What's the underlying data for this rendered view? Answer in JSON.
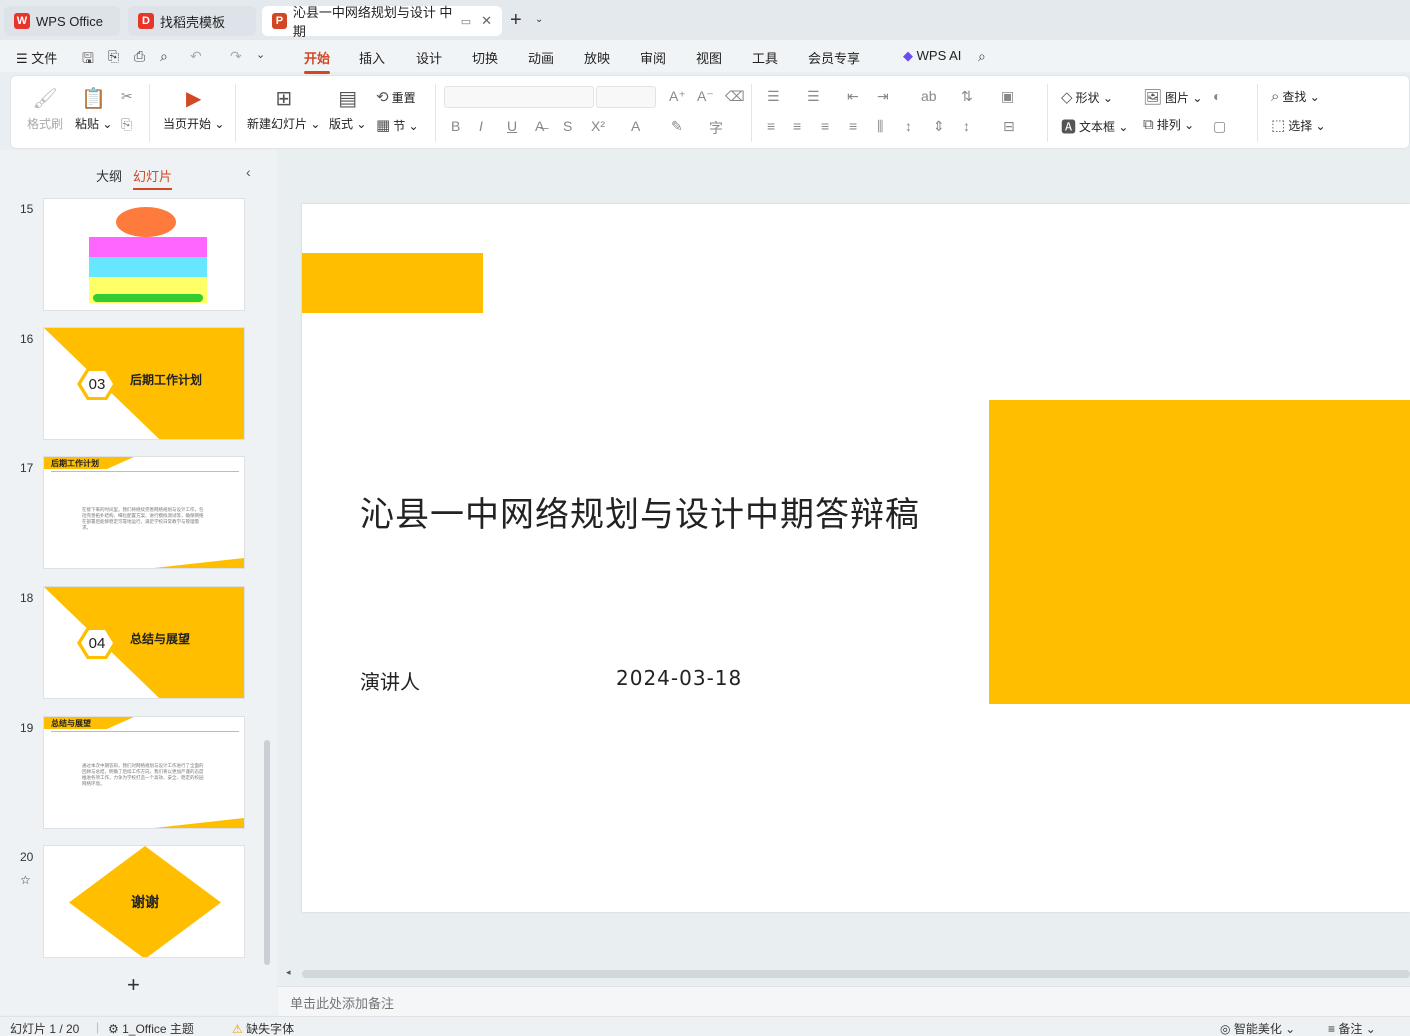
{
  "tabs": [
    {
      "label": "WPS Office",
      "logo": "W"
    },
    {
      "label": "找稻壳模板",
      "logo": "D"
    },
    {
      "label": "沁县一中网络规划与设计 中期",
      "logo": "P"
    }
  ],
  "menu": {
    "file": "文件",
    "items": [
      "开始",
      "插入",
      "设计",
      "切换",
      "动画",
      "放映",
      "审阅",
      "视图",
      "工具",
      "会员专享"
    ],
    "active": "开始",
    "ai": "WPS AI"
  },
  "ribbon": {
    "format_painter": "格式刷",
    "paste": "粘贴",
    "play_from_current": "当页开始",
    "new_slide": "新建幻灯片",
    "layout": "版式",
    "reset": "重置",
    "section": "节",
    "shape": "形状",
    "picture": "图片",
    "textbox": "文本框",
    "arrange": "排列",
    "find": "查找",
    "select": "选择"
  },
  "left_panel": {
    "tab_outline": "大纲",
    "tab_slides": "幻灯片",
    "slide_numbers": [
      "15",
      "16",
      "17",
      "18",
      "19",
      "20"
    ],
    "thumb16_num": "03",
    "thumb16_title": "后期工作计划",
    "thumb17_head": "后期工作计划",
    "thumb17_para": "在接下来的时间里，我们将继续完善网络规划与设计工作，包括完善拓扑结构、细化配置方案、进行模拟测试等，确保网络在部署后能够稳定可靠地运行，满足学校日常教学与管理需求。",
    "thumb18_num": "04",
    "thumb18_title": "总结与展望",
    "thumb19_head": "总结与展望",
    "thumb19_para": "通过本次中期答辩，我们对网络规划与设计工作进行了全面的回顾与总结，明确了后续工作方向。我们将以更加严谨的态度推进各项工作，力争为学校打造一个高效、安全、稳定的校园网络环境。",
    "thumb20_title": "谢谢"
  },
  "slide": {
    "title": "沁县一中网络规划与设计中期答辩稿",
    "presenter": "演讲人",
    "date": "2024-03-18",
    "accent_color": "#FFBF00"
  },
  "notes_placeholder": "单击此处添加备注",
  "status": {
    "slide_counter": "幻灯片 1 / 20",
    "theme": "1_Office 主题",
    "missing_fonts": "缺失字体",
    "smart_beautify": "智能美化",
    "notes": "备注"
  }
}
